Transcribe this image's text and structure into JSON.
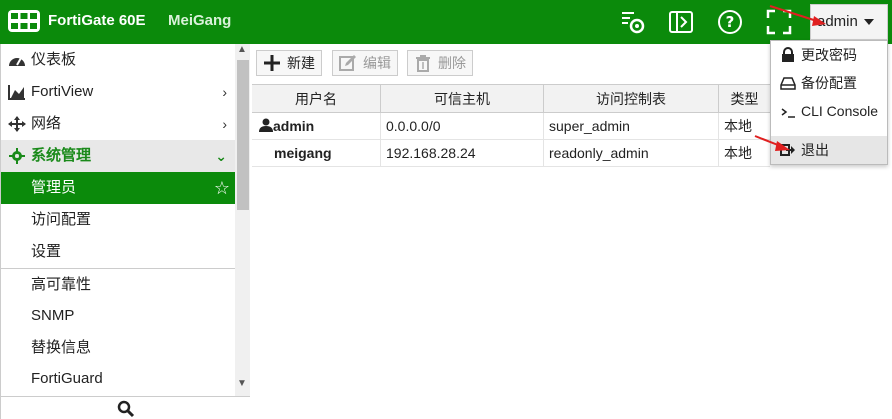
{
  "header": {
    "product": "FortiGate 60E",
    "hostname": "MeiGang",
    "user": "admin",
    "icons": [
      "cli-settings-icon",
      "transfer-icon",
      "help-icon",
      "fullscreen-icon"
    ]
  },
  "sidebar": {
    "items": [
      {
        "label": "仪表板",
        "icon": "dashboard-icon"
      },
      {
        "label": "FortiView",
        "icon": "chart-icon"
      },
      {
        "label": "网络",
        "icon": "network-icon"
      },
      {
        "label": "系统管理",
        "icon": "gear-icon"
      },
      {
        "label": "管理员"
      },
      {
        "label": "访问配置"
      },
      {
        "label": "设置"
      },
      {
        "label": "高可靠性"
      },
      {
        "label": "SNMP"
      },
      {
        "label": "替换信息"
      },
      {
        "label": "FortiGuard"
      }
    ]
  },
  "toolbar": {
    "new_label": "新建",
    "edit_label": "编辑",
    "delete_label": "删除"
  },
  "table": {
    "headers": [
      "用户名",
      "可信主机",
      "访问控制表",
      "类型"
    ],
    "rows": [
      [
        "admin",
        "0.0.0.0/0",
        "super_admin",
        "本地"
      ],
      [
        "meigang",
        "192.168.28.24",
        "readonly_admin",
        "本地"
      ]
    ]
  },
  "dropdown": {
    "items": [
      "更改密码",
      "备份配置",
      "CLI Console",
      "退出"
    ]
  },
  "colors": {
    "brand_green": "#0b8a0b",
    "section_text": "#1a8a1a",
    "arrow_red": "#e02020"
  }
}
